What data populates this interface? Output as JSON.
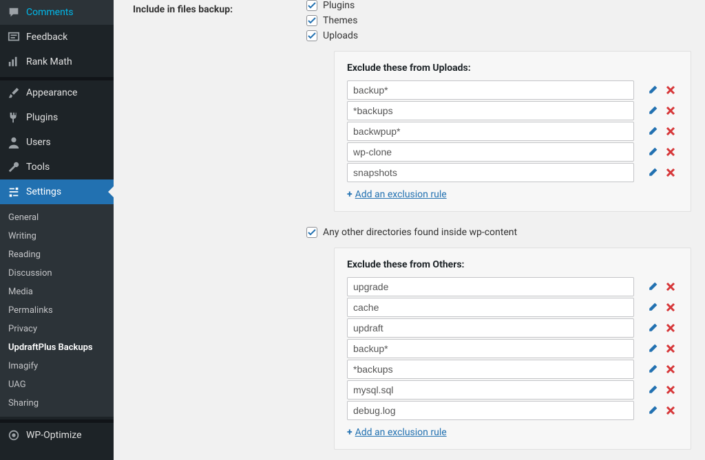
{
  "sidebar": {
    "top": [
      {
        "icon": "comment",
        "label": "Comments"
      },
      {
        "icon": "feedback",
        "label": "Feedback"
      },
      {
        "icon": "chart",
        "label": "Rank Math"
      }
    ],
    "mid": [
      {
        "icon": "brush",
        "label": "Appearance"
      },
      {
        "icon": "plug",
        "label": "Plugins"
      },
      {
        "icon": "user",
        "label": "Users"
      },
      {
        "icon": "wrench",
        "label": "Tools"
      },
      {
        "icon": "sliders",
        "label": "Settings",
        "active": true
      }
    ],
    "sub": [
      {
        "label": "General"
      },
      {
        "label": "Writing"
      },
      {
        "label": "Reading"
      },
      {
        "label": "Discussion"
      },
      {
        "label": "Media"
      },
      {
        "label": "Permalinks"
      },
      {
        "label": "Privacy"
      },
      {
        "label": "UpdraftPlus Backups",
        "current": true
      },
      {
        "label": "Imagify"
      },
      {
        "label": "UAG"
      },
      {
        "label": "Sharing"
      }
    ],
    "bottom": [
      {
        "icon": "optimize",
        "label": "WP-Optimize"
      }
    ]
  },
  "main": {
    "include_label": "Include in files backup:",
    "checks": {
      "plugins": "Plugins",
      "themes": "Themes",
      "uploads": "Uploads",
      "anyother": "Any other directories found inside wp-content"
    },
    "uploads_box": {
      "title": "Exclude these from Uploads:",
      "rules": [
        "backup*",
        "*backups",
        "backwpup*",
        "wp-clone",
        "snapshots"
      ],
      "add": "Add an exclusion rule"
    },
    "others_box": {
      "title": "Exclude these from Others:",
      "rules": [
        "upgrade",
        "cache",
        "updraft",
        "backup*",
        "*backups",
        "mysql.sql",
        "debug.log"
      ],
      "add": "Add an exclusion rule"
    }
  }
}
